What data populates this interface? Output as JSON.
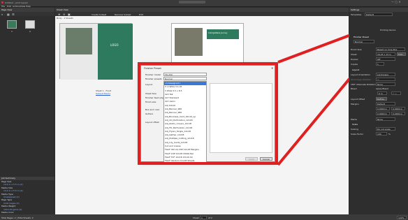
{
  "app_title": "Untitled – print layout",
  "menu": [
    "File",
    "Edit",
    "Actions",
    "View",
    "Help"
  ],
  "page_view_title": "Page View",
  "sheet_view_title": "Sheet View",
  "toolbar": {
    "create_subset": "Create Subset",
    "remove_subset": "Remove Subset",
    "edit": "Edit"
  },
  "tree_item": "Body - 2 Sheets",
  "thumb_labels": [
    "1",
    "2"
  ],
  "sheet_info": {
    "line1": "Sheet 1 - Front",
    "line2": "Default Media"
  },
  "job_summary": {
    "title": "Job Summary",
    "rows": [
      "Page Size",
      "14.2 in x 5.5 in (2)",
      "Media Size",
      "14.2 in x 5.5 in (2)",
      "Media Type",
      "Unassigned (2)",
      "Page Type",
      "Solid pages (2)",
      "Media Weight",
      "100-120 g/m2 (2)",
      "Media Color"
    ]
  },
  "status": {
    "left": "Total Pages: 2 | Total Sheets: 2",
    "sheet_label": "Sheet",
    "sheet_value": "1",
    "sheet_of": "of 2",
    "zoom": "100%"
  },
  "settings": {
    "title": "Settings",
    "template_label": "Templates",
    "template_value": "Default",
    "finisher_preset_label": "Finisher Preset",
    "finisher_preset_value": "Normal",
    "rows": [
      {
        "label": "Finish Size",
        "value": "Based on Crop Box"
      },
      {
        "label": "Sheet",
        "value": "16.25 x 13 in"
      },
      {
        "label": "Duplex",
        "value": "Off"
      },
      {
        "label": "Copies",
        "value": "1"
      }
    ],
    "layout_header": "Layout",
    "layout_rows": [
      {
        "label": "Layout Orientation",
        "value": "Landscape"
      },
      {
        "label": "Work Page Rotation",
        "value": "0°"
      },
      {
        "label": "180° Alternate Rotation",
        "value": "None"
      },
      {
        "label": "Bleed",
        "value": "Apply Bleed"
      }
    ],
    "bleed_values": [
      "0 in",
      "0 in"
    ],
    "layout_offset_label": "Layout Offset",
    "define_label": "Define...",
    "margins_label": "Margins",
    "margins_value": "Default",
    "margin_values": [
      "0.0000 in",
      "0.0000 in",
      "0.0000 in",
      "0.0000 in"
    ],
    "marks_label": "Marks",
    "marks_value": "None",
    "scale_header": "Scale",
    "scaling_label": "Scaling",
    "scaling_value": "Do not scale",
    "scale_factor_label": "Scale Factor",
    "scale_factor_value": "100",
    "scale_unit": "%",
    "edit_button": "Edit...",
    "printing_device": "Printing device"
  },
  "dialog": {
    "title": "Finisher Preset",
    "labels": [
      "Finisher model",
      "Finisher presets",
      "Layout",
      "Sheet Size",
      "Finisher feed edge",
      "Finish size",
      "Box and color",
      "Gutters",
      "Layout offset"
    ],
    "model_value": "FD-250",
    "preset_value": "Normal",
    "presets": [
      "<Unassigned>",
      "3 in Wide 1in x6",
      "3 Wide 5.5 x 8.5",
      "4x3 Tall",
      "4x7 Standard",
      "4x7 demo",
      "Adj 10x10",
      "Adj_Banner_980",
      "Adj_Banner_980",
      "Adj_Business_Card_10x10_up",
      "Adj_CD_Perforation_12x18",
      "Adj_Distro_Covers_12x18",
      "Adj_FD_Perforation_12x18",
      "Adj_Flyers_Single_12x18",
      "Adj_Gather_12x18",
      "Adj_Multiple_Cutting_12x18",
      "Adj_Lily_Cards_12x18",
      "Cut and crease",
      "FlexF ISO A4 2UP 12x18 Margins",
      "FlexF 2UP 12x18 2000s Rel",
      "FlexF TCF 12x18 13x19 On",
      "FlexF Vendors 11x18 Sheets"
    ],
    "apply_label": "Apply",
    "cancel_label": "Cancel"
  },
  "cards": {
    "left_title": "Unforgettable Journey",
    "right_title": "Unforgettable Journey",
    "brand": "LOGO"
  }
}
